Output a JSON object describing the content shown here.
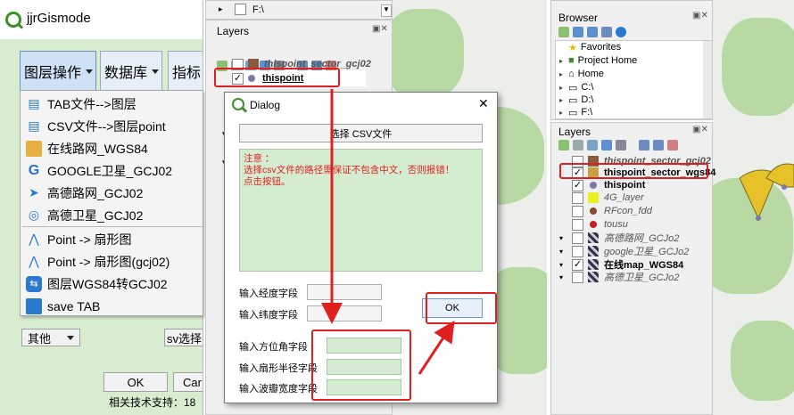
{
  "left_window": {
    "title": "jjrGismode",
    "menus": [
      {
        "label": "图层操作"
      },
      {
        "label": "数据库"
      },
      {
        "label": "指标"
      }
    ],
    "dropdown_items": [
      {
        "label": "TAB文件-->图层",
        "icon": "tab-file-icon"
      },
      {
        "label": "CSV文件-->图层point",
        "icon": "csv-file-icon"
      },
      {
        "label": "在线路网_WGS84",
        "icon": "road-map-icon"
      },
      {
        "label": "GOOGLE卫星_GCJ02",
        "icon": "google-icon"
      },
      {
        "label": "高德路网_GCJ02",
        "icon": "send-icon"
      },
      {
        "label": "高德卫星_GCJ02",
        "icon": "globe-icon"
      },
      {
        "label": "Point -> 扇形图",
        "icon": "sector-icon"
      },
      {
        "label": "Point -> 扇形图(gcj02)",
        "icon": "sector-icon"
      },
      {
        "label": "图层WGS84转GCJ02",
        "icon": "convert-icon"
      },
      {
        "label": "save TAB",
        "icon": "save-icon"
      }
    ],
    "other_select": "其他",
    "csv_button": "sv选择",
    "ok_button": "OK",
    "cancel_button": "Car",
    "footer": "相关技术支持：18"
  },
  "middle": {
    "path_item": "F:\\",
    "layers_title": "Layers",
    "layers": [
      {
        "name": "thispoint_sector_gcj02"
      },
      {
        "name": "thispoint"
      }
    ],
    "dialog": {
      "title": "Dialog",
      "select_csv_button": "选择 CSV文件",
      "note_line1": "注意 ：",
      "note_line2": "选择csv文件的路径需保证不包含中文，否则报错！",
      "note_line3": "点击按钮。",
      "field_lon": "输入经度字段",
      "field_lat": "输入纬度字段",
      "field_azimuth": "输入方位角字段",
      "field_radius": "输入扇形半径字段",
      "field_beamwidth": "输入波瓣宽度字段",
      "ok_button": "OK"
    }
  },
  "right": {
    "browser_title": "Browser",
    "browser_items": [
      {
        "label": "Favorites",
        "icon": "star-icon"
      },
      {
        "label": "Project Home",
        "icon": "project-icon"
      },
      {
        "label": "Home",
        "icon": "home-icon"
      },
      {
        "label": "C:\\",
        "icon": "drive-icon"
      },
      {
        "label": "D:\\",
        "icon": "drive-icon"
      },
      {
        "label": "F:\\",
        "icon": "drive-icon"
      }
    ],
    "layers_title": "Layers",
    "layers": [
      {
        "name": "thispoint_sector_gcj02"
      },
      {
        "name": "thispoint_sector_wgs84"
      },
      {
        "name": "thispoint"
      },
      {
        "name": "4G_layer"
      },
      {
        "name": "RFcon_fdd"
      },
      {
        "name": "tousu"
      },
      {
        "name": "高德路网_GCJo2"
      },
      {
        "name": "google卫星_GCJo2"
      },
      {
        "name": "在线map_WGS84"
      },
      {
        "name": "高德卫星_GCJo2"
      }
    ]
  },
  "colors": {
    "accent_red": "#e02020",
    "panel_green": "#d8ecd0",
    "map_green": "#b8d8a4",
    "sector_yellow": "#e6c22a"
  }
}
